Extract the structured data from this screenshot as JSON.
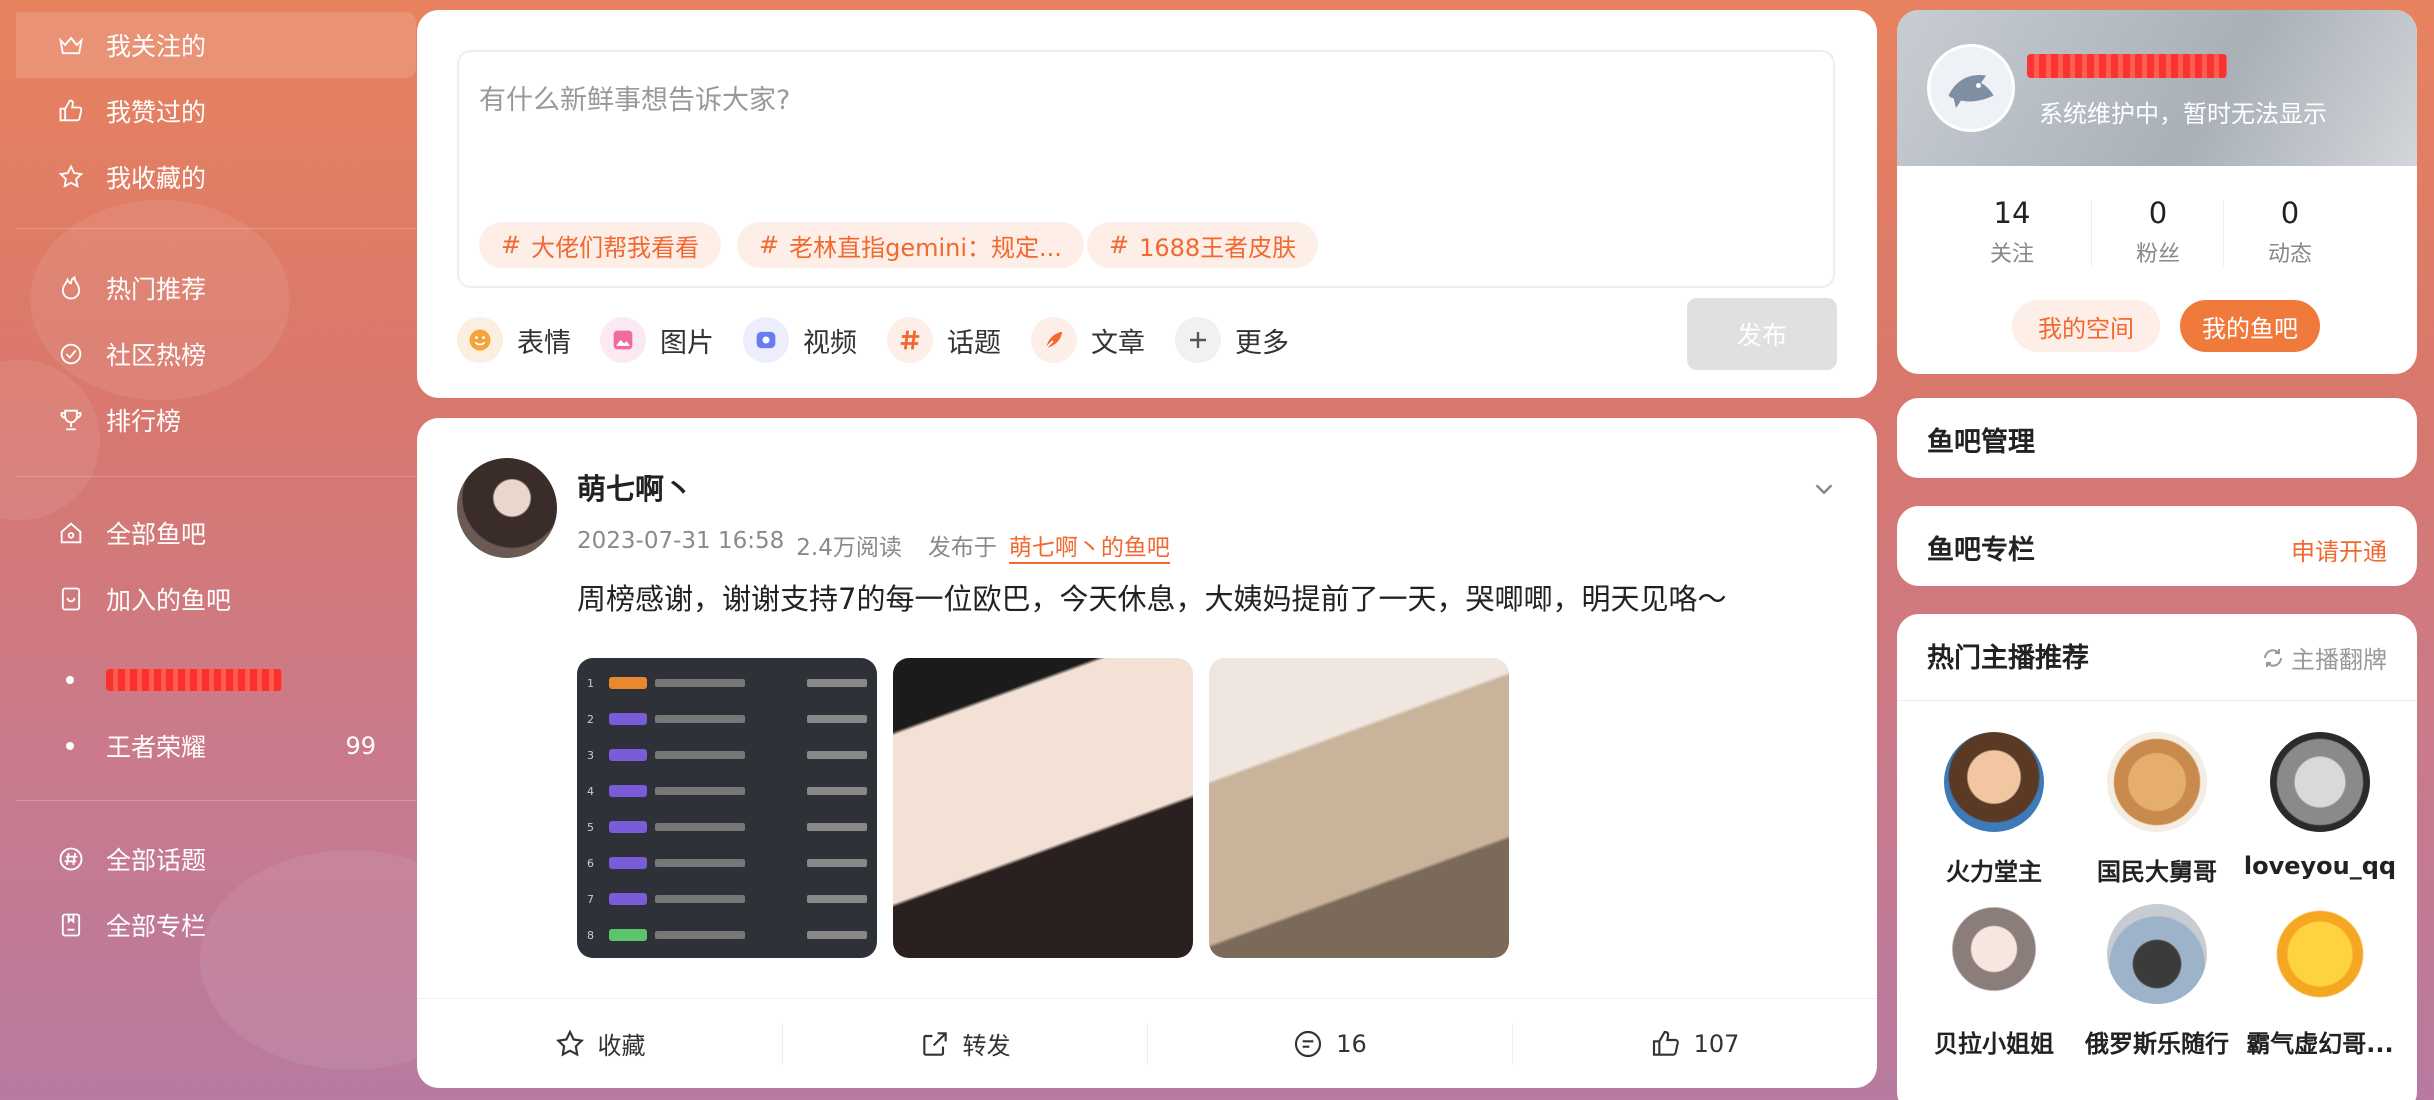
{
  "sidebar": {
    "items": [
      {
        "label": "我关注的",
        "icon": "crown-icon"
      },
      {
        "label": "我赞过的",
        "icon": "thumbs-up-icon"
      },
      {
        "label": "我收藏的",
        "icon": "star-icon"
      },
      {
        "label": "热门推荐",
        "icon": "fire-icon"
      },
      {
        "label": "社区热榜",
        "icon": "hot-list-icon"
      },
      {
        "label": "排行榜",
        "icon": "trophy-icon"
      },
      {
        "label": "全部鱼吧",
        "icon": "home-icon"
      },
      {
        "label": "加入的鱼吧",
        "icon": "joined-icon"
      }
    ],
    "joined_bars": [
      {
        "label": "",
        "redacted": true
      },
      {
        "label": "王者荣耀",
        "count": "99"
      }
    ],
    "bottom_items": [
      {
        "label": "全部话题",
        "icon": "hashtag-icon"
      },
      {
        "label": "全部专栏",
        "icon": "column-icon"
      }
    ]
  },
  "composer": {
    "placeholder": "有什么新鲜事想告诉大家?",
    "topics": [
      "大佬们帮我看看",
      "老林直指gemini：规定...",
      "1688王者皮肤"
    ],
    "tools": [
      {
        "label": "表情",
        "icon": "emoji-icon",
        "color": "#f7a23a"
      },
      {
        "label": "图片",
        "icon": "image-icon",
        "color": "#f06ba0"
      },
      {
        "label": "视频",
        "icon": "video-icon",
        "color": "#6a7bf0"
      },
      {
        "label": "话题",
        "icon": "hashtag-icon",
        "color": "#f2682f"
      },
      {
        "label": "文章",
        "icon": "article-icon",
        "color": "#f2682f"
      },
      {
        "label": "更多",
        "icon": "plus-icon",
        "color": "#666666"
      }
    ],
    "publish_label": "发布"
  },
  "post": {
    "author": "萌七啊丶",
    "time": "2023-07-31 16:58",
    "reads": "2.4万阅读",
    "posted_in_label": "发布于",
    "bar_name": "萌七啊丶的鱼吧",
    "text": "周榜感谢，谢谢支持7的每一位欧巴，今天休息，大姨妈提前了一天，哭唧唧，明天见咯～",
    "images": [
      "ranking-screenshot",
      "selfie-1",
      "selfie-2"
    ],
    "actions": [
      {
        "label": "收藏",
        "icon": "star-icon"
      },
      {
        "label": "转发",
        "icon": "share-icon"
      },
      {
        "label": "16",
        "icon": "comment-icon"
      },
      {
        "label": "107",
        "icon": "thumbs-up-icon"
      }
    ]
  },
  "profile": {
    "subtitle": "系统维护中，暂时无法显示",
    "stats": [
      {
        "value": "14",
        "label": "关注"
      },
      {
        "value": "0",
        "label": "粉丝"
      },
      {
        "value": "0",
        "label": "动态"
      }
    ],
    "my_space_label": "我的空间",
    "my_bar_label": "我的鱼吧"
  },
  "bar_manage": {
    "title": "鱼吧管理"
  },
  "bar_column": {
    "title": "鱼吧专栏",
    "link": "申请开通"
  },
  "hot_streamers": {
    "title": "热门主播推荐",
    "refresh_label": "主播翻牌",
    "items": [
      {
        "name": "火力堂主"
      },
      {
        "name": "国民大舅哥"
      },
      {
        "name": "loveyou_qq"
      },
      {
        "name": "贝拉小姐姐"
      },
      {
        "name": "俄罗斯乐随行"
      },
      {
        "name": "霸气虚幻哥..."
      }
    ]
  },
  "colors": {
    "accent": "#f2682f",
    "accent_light": "#fdeee8"
  }
}
